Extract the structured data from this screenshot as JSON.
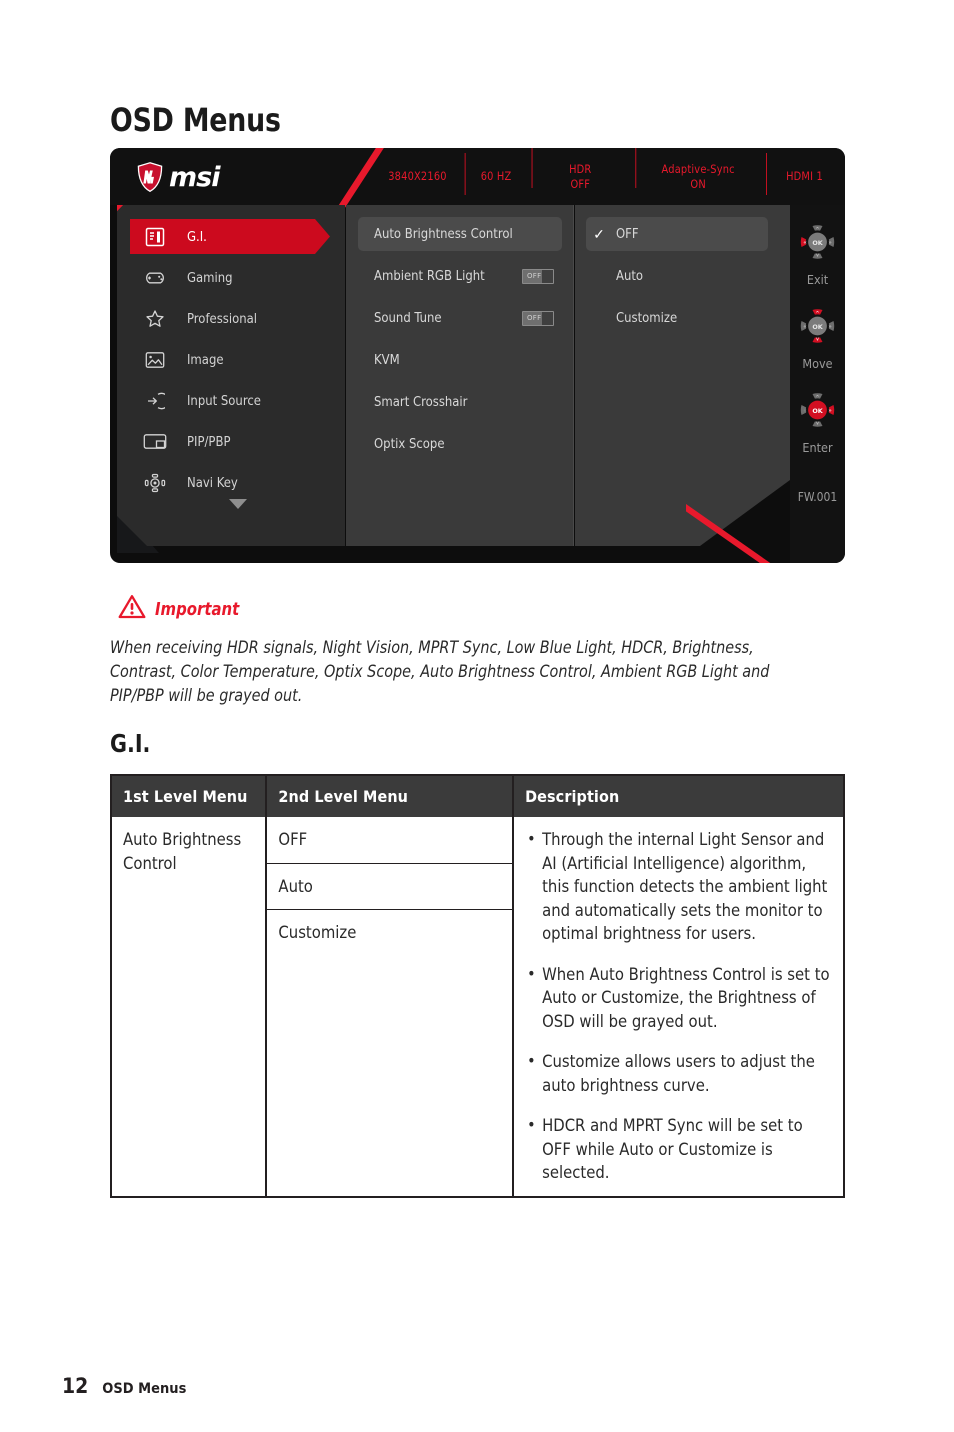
{
  "page": {
    "title": "OSD Menus",
    "section_title": "G.I.",
    "footer_page_number": "12",
    "footer_label": "OSD Menus"
  },
  "colors": {
    "msi_red": "#e8192c",
    "accent_red": "#cc0a1e",
    "panel_dark": "#2b2b2b",
    "panel_mid": "#3a3a3a",
    "selected": "#4b4b4b",
    "header_black": "#111111"
  },
  "osd": {
    "logo_text": "msi",
    "logo_icon": "msi-dragon-shield-icon",
    "status_bar": [
      {
        "name": "resolution",
        "line1": "3840X2160",
        "line2": ""
      },
      {
        "name": "refresh-rate",
        "line1": "60 HZ",
        "line2": ""
      },
      {
        "name": "hdr",
        "line1": "HDR",
        "line2": "OFF"
      },
      {
        "name": "adaptive-sync",
        "line1": "Adaptive-Sync",
        "line2": "ON"
      },
      {
        "name": "input",
        "line1": "HDMI 1",
        "line2": ""
      }
    ],
    "sidebar": {
      "items": [
        {
          "label": "G.I.",
          "icon": "gi-icon",
          "active": true
        },
        {
          "label": "Gaming",
          "icon": "gamepad-icon",
          "active": false
        },
        {
          "label": "Professional",
          "icon": "star-icon",
          "active": false
        },
        {
          "label": "Image",
          "icon": "picture-icon",
          "active": false
        },
        {
          "label": "Input Source",
          "icon": "input-arrow-icon",
          "active": false
        },
        {
          "label": "PIP/PBP",
          "icon": "pip-window-icon",
          "active": false
        },
        {
          "label": "Navi Key",
          "icon": "navi-key-icon",
          "active": false
        }
      ],
      "more_indicator": "chevron-down-icon"
    },
    "middle_menu": [
      {
        "label": "Auto Brightness Control",
        "selected": true,
        "toggle": null
      },
      {
        "label": "Ambient RGB Light",
        "selected": false,
        "toggle": "OFF"
      },
      {
        "label": "Sound Tune",
        "selected": false,
        "toggle": "OFF"
      },
      {
        "label": "KVM",
        "selected": false,
        "toggle": null
      },
      {
        "label": "Smart Crosshair",
        "selected": false,
        "toggle": null
      },
      {
        "label": "Optix Scope",
        "selected": false,
        "toggle": null
      }
    ],
    "options": [
      {
        "label": "OFF",
        "checked": true,
        "check_glyph": "✓"
      },
      {
        "label": "Auto",
        "checked": false,
        "check_glyph": ""
      },
      {
        "label": "Customize",
        "checked": false,
        "check_glyph": ""
      }
    ],
    "nav_keys": [
      {
        "label": "Exit",
        "icon": "nav-key-left-icon",
        "center": "OK",
        "highlight": "left"
      },
      {
        "label": "Move",
        "icon": "nav-key-updown-icon",
        "center": "OK",
        "highlight": "updown"
      },
      {
        "label": "Enter",
        "icon": "nav-key-ok-icon",
        "center": "OK",
        "highlight": "center-right"
      }
    ],
    "firmware": "FW.001"
  },
  "important": {
    "icon": "warning-triangle-icon",
    "title": "Important",
    "text": "When receiving HDR signals, Night Vision, MPRT Sync, Low Blue Light, HDCR, Brightness, Contrast, Color Temperature, Optix Scope, Auto Brightness Control, Ambient RGB Light and PIP/PBP will be grayed out."
  },
  "table": {
    "headers": [
      "1st Level Menu",
      "2nd Level Menu",
      "Description"
    ],
    "first_level": "Auto Brightness Control",
    "second_level": [
      "OFF",
      "Auto",
      "Customize"
    ],
    "description": [
      "Through the internal Light Sensor and AI (Artificial Intelligence) algorithm, this function detects the ambient light and automatically sets the monitor to optimal brightness for users.",
      "When Auto Brightness Control is set to Auto or Customize, the Brightness of OSD will be grayed out.",
      "Customize allows users to adjust the auto brightness curve.",
      "HDCR and MPRT Sync will be set to OFF while Auto or Customize is selected."
    ]
  }
}
